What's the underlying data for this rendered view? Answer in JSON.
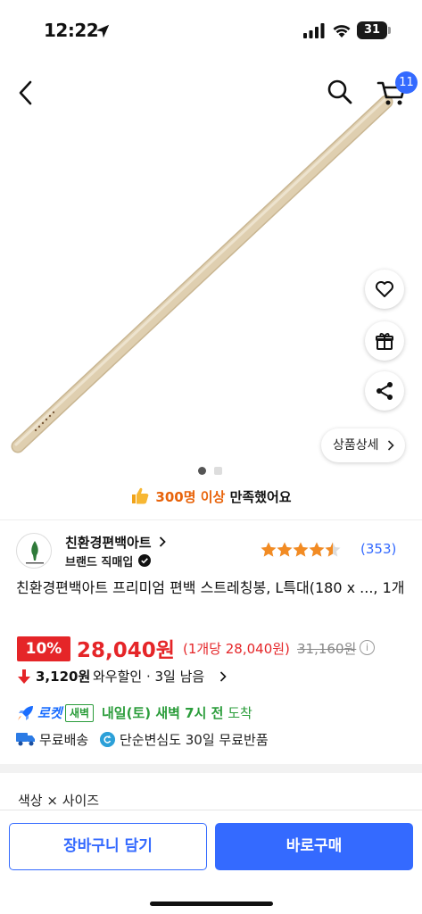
{
  "status_bar": {
    "time": "12:22",
    "battery": "31"
  },
  "nav": {
    "cart_count": "11"
  },
  "colors": {
    "accent": "#346aff",
    "discount_red": "#e52528",
    "rocket_green": "#2b9d3b",
    "satisfaction_orange": "#e8630a"
  },
  "icons": [
    "back-icon",
    "search-icon",
    "cart-icon",
    "heart-icon",
    "gift-icon",
    "share-icon",
    "thumbs-up-icon",
    "star-icon",
    "verified-icon",
    "rocket-icon",
    "truck-icon",
    "return-icon",
    "info-icon"
  ],
  "image_gallery": {
    "detail_button": "상품상세",
    "current_index": 1,
    "total": 2
  },
  "satisfaction": {
    "highlight": "300명 이상",
    "text": " 만족했어요"
  },
  "seller": {
    "name": "친환경편백아트",
    "badge": "브랜드 직매입"
  },
  "rating": {
    "stars": 4.5,
    "max": 5,
    "review_count": "(353)"
  },
  "product": {
    "title": "친환경편백아트 프리미엄 편백 스트레칭봉, L특대(180 x ..., 1개"
  },
  "price": {
    "discount": "10%",
    "sale_price": "28,040원",
    "unit_price": "(1개당 28,040원)",
    "original_price": "31,160원",
    "info": "i"
  },
  "wow_discount": {
    "amount": "3,120원",
    "text": "와우할인 · 3일 남음"
  },
  "delivery": {
    "rocket_label": "로켓",
    "dawn_badge": "새벽",
    "arrival_date": "내일(토) 새벽 7시 전",
    "arrival_suffix": " 도착",
    "free_shipping": "무료배송",
    "free_return": "단순변심도 30일 무료반품"
  },
  "options": {
    "label": "색상 × 사이즈"
  },
  "actions": {
    "add_to_cart": "장바구니 담기",
    "buy_now": "바로구매"
  }
}
